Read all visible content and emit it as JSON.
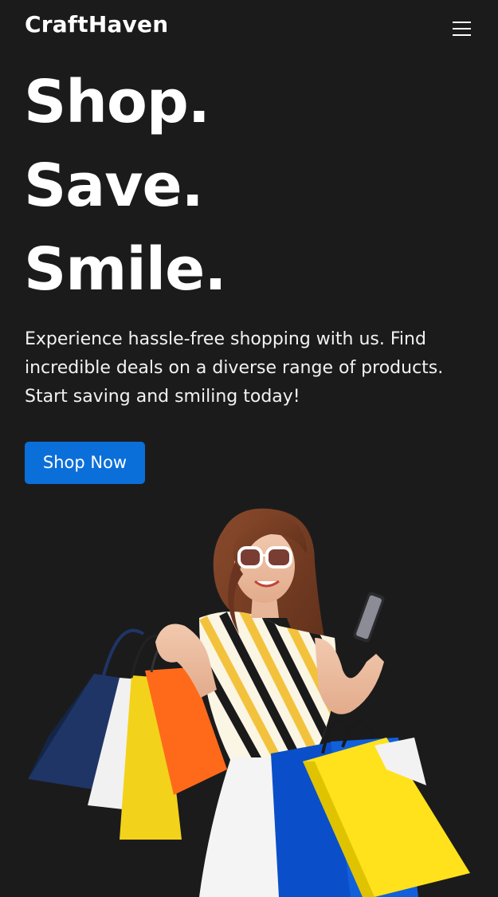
{
  "header": {
    "logo": "CraftHaven",
    "menu_icon": "hamburger-menu-icon"
  },
  "hero": {
    "headline_lines": [
      "Shop.",
      "Save.",
      "Smile."
    ],
    "tagline": "Experience hassle-free shopping with us. Find incredible deals on a diverse range of products. Start saving and smiling today!",
    "cta_label": "Shop Now",
    "image_alt": "Smiling woman holding shopping bags and a phone"
  },
  "colors": {
    "background": "#1b1b1c",
    "text": "#ffffff",
    "accent": "#0b6fd9"
  }
}
